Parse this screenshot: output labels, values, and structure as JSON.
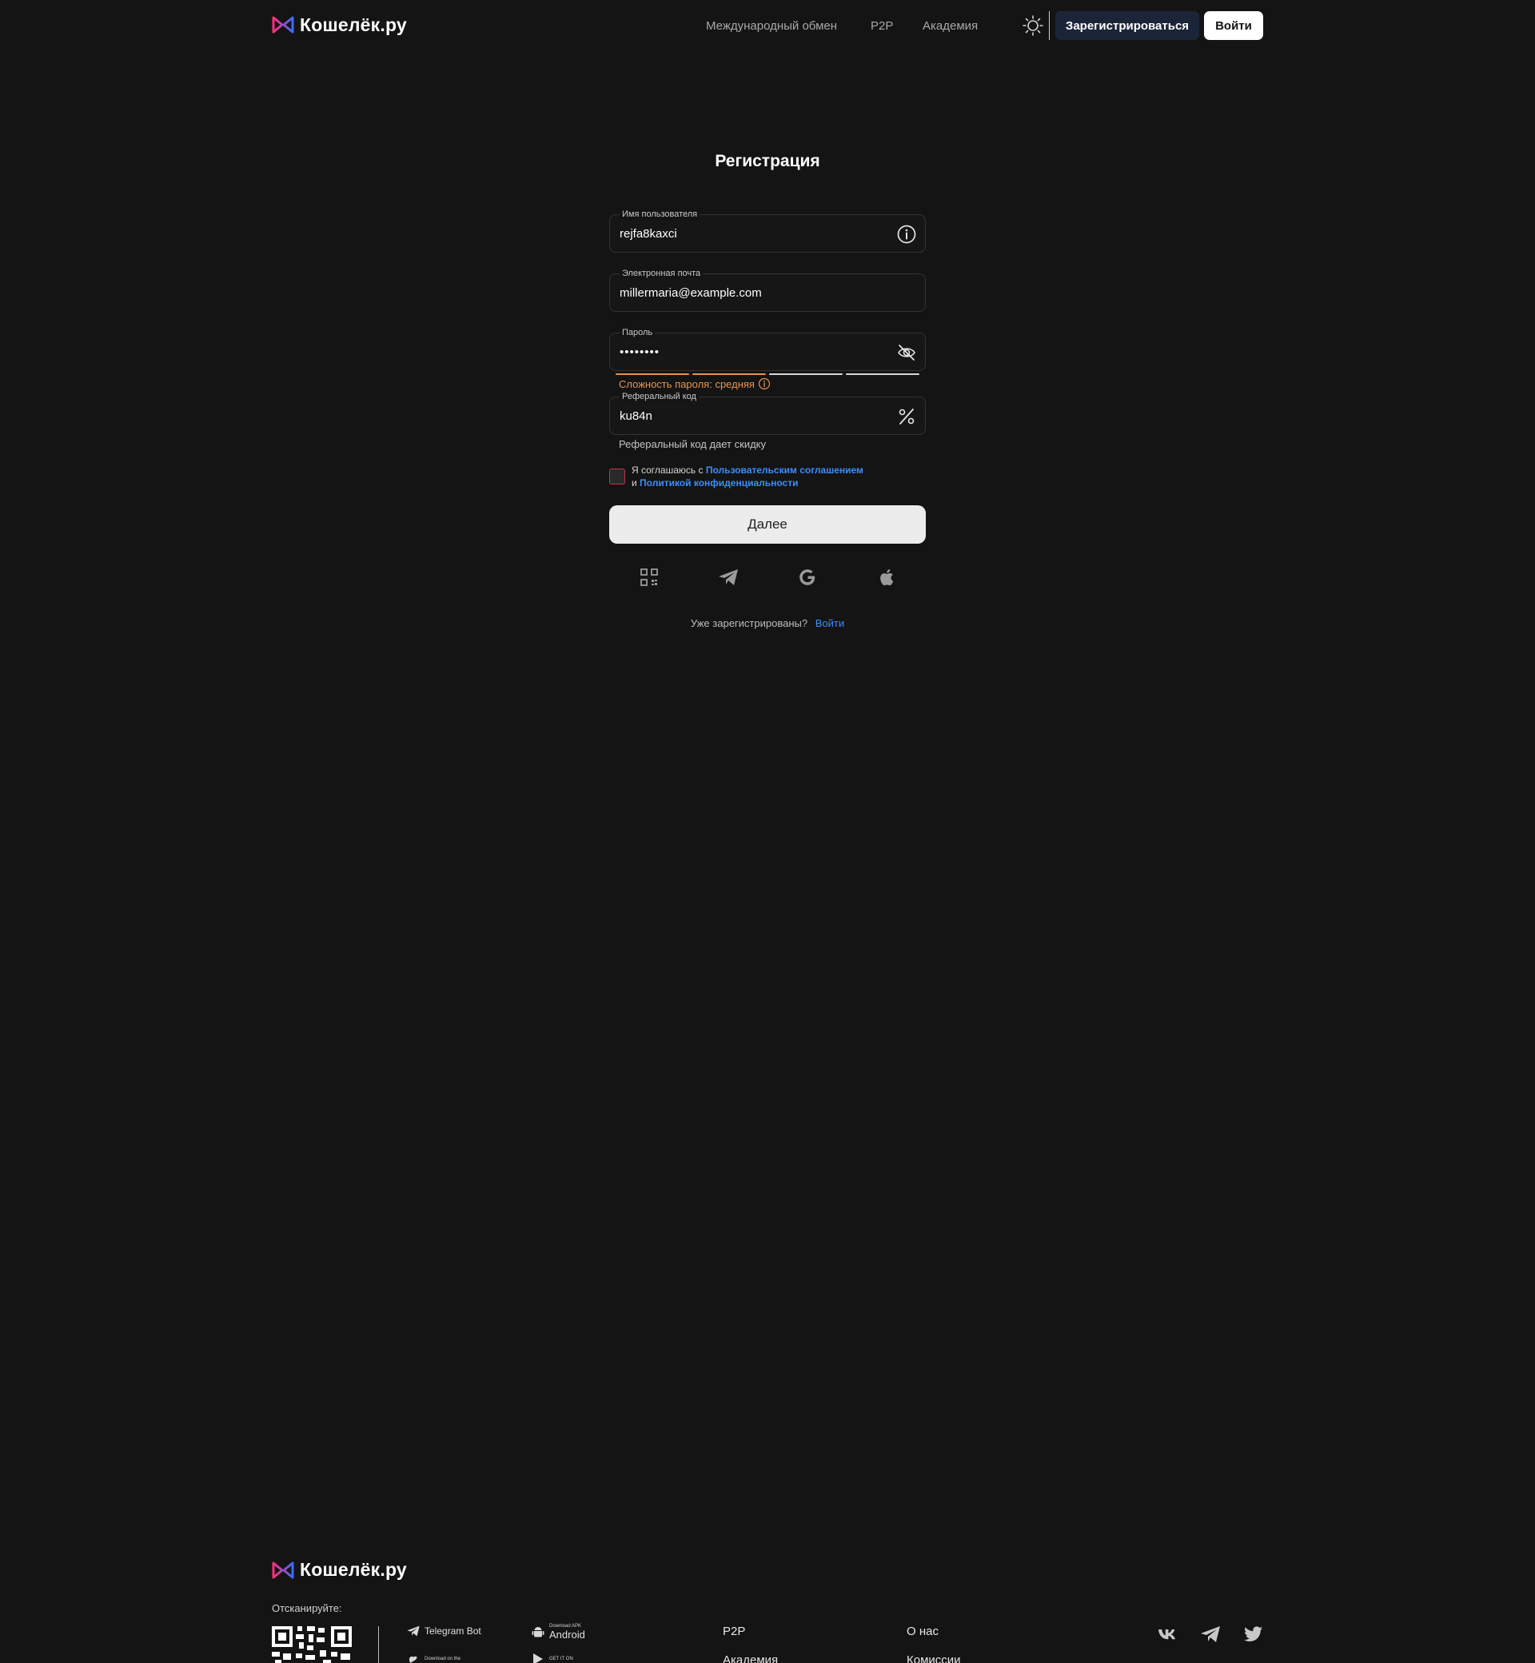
{
  "header": {
    "brand": "Кошелёк.ру",
    "nav": [
      "Международный обмен",
      "P2P",
      "Академия"
    ],
    "register_label": "Зарегистрироваться",
    "login_label": "Войти"
  },
  "form": {
    "title": "Регистрация",
    "username": {
      "label": "Имя пользователя",
      "value": "rejfa8kaxci"
    },
    "email": {
      "label": "Электронная почта",
      "value": "millermaria@example.com"
    },
    "password": {
      "label": "Пароль",
      "value": "••••••••",
      "strength_text": "Сложность пароля: средняя",
      "strength_level": 0.5
    },
    "referral": {
      "label": "Реферальный код",
      "value": "ku84n",
      "hint": "Реферальный код дает скидку"
    },
    "agree": {
      "prefix": "Я соглашаюсь с",
      "terms_link": "Пользовательским соглашением",
      "and": "и",
      "privacy_link": "Политикой конфиденциальности"
    },
    "next_label": "Далее",
    "social_icons": [
      "qr-code-icon",
      "telegram-icon",
      "google-icon",
      "apple-icon"
    ],
    "already_text": "Уже зарегистрированы?",
    "already_link": "Войти"
  },
  "footer": {
    "brand": "Кошелёк.ру",
    "scan_label": "Отсканируйте:",
    "stores": [
      {
        "small": "",
        "big": "Telegram Bot"
      },
      {
        "small": "Download APK",
        "big": "Android"
      },
      {
        "small": "Download on the",
        "big": ""
      },
      {
        "small": "GET IT ON",
        "big": ""
      }
    ],
    "links_col1": [
      "P2P",
      "Академия"
    ],
    "links_col2": [
      "О нас",
      "Комиссии"
    ],
    "social": [
      "vk-icon",
      "telegram-icon",
      "twitter-icon"
    ]
  },
  "colors": {
    "background": "#141414",
    "accent_link": "#3c8dff",
    "strength_medium": "#e8944a",
    "register_button_bg": "#1c2538"
  }
}
